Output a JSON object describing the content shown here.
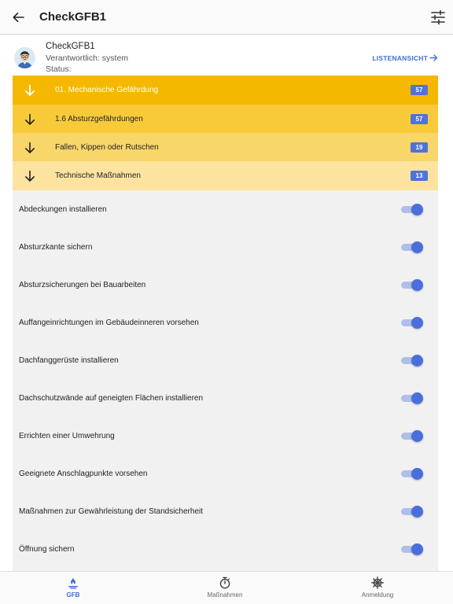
{
  "header": {
    "title": "CheckGFB1",
    "back_icon": "arrow-left-icon",
    "filter_icon": "tune-sliders-icon"
  },
  "card": {
    "name": "CheckGFB1",
    "responsible": "Verantwortlich: system",
    "status": "Status:",
    "list_view_label": "LISTENANSICHT"
  },
  "categories": [
    {
      "label": "01. Mechanische Gefährdung",
      "count": "57"
    },
    {
      "label": "1.6 Absturzgefährdungen",
      "count": "57"
    },
    {
      "label": "Fallen, Kippen oder Rutschen",
      "count": "19"
    },
    {
      "label": "Technische Maßnahmen",
      "count": "13"
    }
  ],
  "measures": [
    {
      "label": "Abdeckungen installieren",
      "enabled": true
    },
    {
      "label": "Absturzkante sichern",
      "enabled": true
    },
    {
      "label": "Absturzsicherungen bei Bauarbeiten",
      "enabled": true
    },
    {
      "label": "Auffangeinrichtungen im Gebäudeinneren vorsehen",
      "enabled": true
    },
    {
      "label": "Dachfanggerüste installieren",
      "enabled": true
    },
    {
      "label": "Dachschutzwände auf geneigten Flächen installieren",
      "enabled": true
    },
    {
      "label": "Errichten einer Umwehrung",
      "enabled": true
    },
    {
      "label": "Geeignete Anschlagpunkte vorsehen",
      "enabled": true
    },
    {
      "label": "Maßnahmen zur Gewährleistung der Standsicherheit",
      "enabled": true
    },
    {
      "label": "Öffnung sichern",
      "enabled": true
    }
  ],
  "nav": [
    {
      "label": "GFB",
      "icon": "gfb-icon",
      "active": true
    },
    {
      "label": "Maßnahmen",
      "icon": "stopwatch-icon",
      "active": false
    },
    {
      "label": "Anmeldung",
      "icon": "ship-wheel-icon",
      "active": false
    }
  ],
  "colors": {
    "accent": "#4a6fdc",
    "category_level_0": "#f5b800",
    "category_level_1": "#f8ca3a",
    "category_level_2": "#f9d66a",
    "category_level_3": "#fce3a0",
    "badge": "#4f74d6"
  }
}
